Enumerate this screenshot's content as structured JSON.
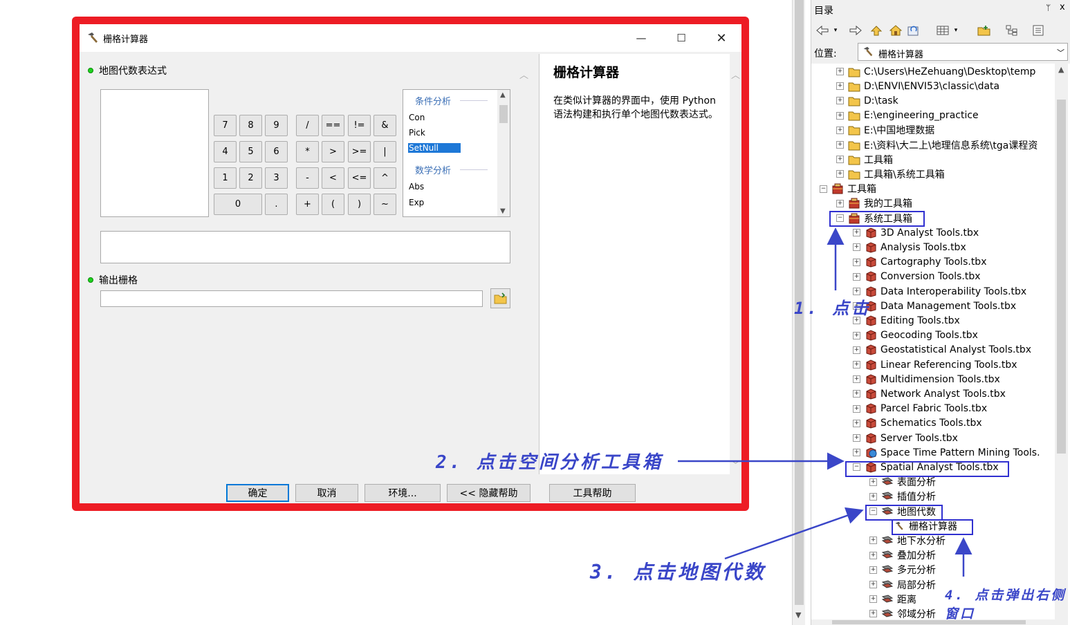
{
  "dialog": {
    "title": "栅格计算器",
    "expr_label": "地图代数表达式",
    "output_label": "输出栅格",
    "calc_buttons": [
      [
        "7",
        "8",
        "9",
        "/",
        "==",
        "!=",
        "&"
      ],
      [
        "4",
        "5",
        "6",
        "*",
        ">",
        ">=",
        "|"
      ],
      [
        "1",
        "2",
        "3",
        "-",
        "<",
        "<=",
        "^"
      ],
      [
        "0",
        ".",
        "+",
        "(",
        ")",
        "~"
      ]
    ],
    "function_list": {
      "groups": [
        {
          "header": "条件分析",
          "items": [
            "Con",
            "Pick",
            "SetNull"
          ]
        },
        {
          "header": "数学分析",
          "items": [
            "Abs",
            "Exp"
          ]
        }
      ],
      "selected": "SetNull"
    },
    "help": {
      "title": "栅格计算器",
      "text": "在类似计算器的界面中，使用 Python 语法构建和执行单个地图代数表达式。"
    },
    "buttons": {
      "ok": "确定",
      "cancel": "取消",
      "env": "环境...",
      "hide_help": "<< 隐藏帮助",
      "tool_help": "工具帮助"
    },
    "window_controls": {
      "min": "—",
      "max": "☐",
      "close": "✕"
    }
  },
  "catalog": {
    "title": "目录",
    "pin": "ᛘ",
    "close": "x",
    "location_label": "位置:",
    "location_value": "栅格计算器",
    "tree": [
      {
        "label": "C:\\Users\\HeZehuang\\Desktop\\temp",
        "type": "folder",
        "level": 1,
        "expander": "+"
      },
      {
        "label": "D:\\ENVI\\ENVI53\\classic\\data",
        "type": "folder",
        "level": 1,
        "expander": "+"
      },
      {
        "label": "D:\\task",
        "type": "folder",
        "level": 1,
        "expander": "+"
      },
      {
        "label": "E:\\engineering_practice",
        "type": "folder",
        "level": 1,
        "expander": "+"
      },
      {
        "label": "E:\\中国地理数据",
        "type": "folder",
        "level": 1,
        "expander": "+"
      },
      {
        "label": "E:\\资料\\大二上\\地理信息系统\\tga课程资",
        "type": "folder",
        "level": 1,
        "expander": "+"
      },
      {
        "label": "工具箱",
        "type": "folder",
        "level": 1,
        "expander": "+"
      },
      {
        "label": "工具箱\\系统工具箱",
        "type": "folder",
        "level": 1,
        "expander": "+"
      },
      {
        "label": "工具箱",
        "type": "toolboxes",
        "level": 0,
        "expander": "−"
      },
      {
        "label": "我的工具箱",
        "type": "toolboxes",
        "level": 1,
        "expander": "+"
      },
      {
        "label": "系统工具箱",
        "type": "toolboxes",
        "level": 1,
        "expander": "−"
      },
      {
        "label": "3D Analyst Tools.tbx",
        "type": "tbx",
        "level": 2,
        "expander": "+"
      },
      {
        "label": "Analysis Tools.tbx",
        "type": "tbx",
        "level": 2,
        "expander": "+"
      },
      {
        "label": "Cartography Tools.tbx",
        "type": "tbx",
        "level": 2,
        "expander": "+"
      },
      {
        "label": "Conversion Tools.tbx",
        "type": "tbx",
        "level": 2,
        "expander": "+"
      },
      {
        "label": "Data Interoperability Tools.tbx",
        "type": "tbx",
        "level": 2,
        "expander": "+"
      },
      {
        "label": "Data Management Tools.tbx",
        "type": "tbx",
        "level": 2,
        "expander": "+"
      },
      {
        "label": "Editing Tools.tbx",
        "type": "tbx",
        "level": 2,
        "expander": "+"
      },
      {
        "label": "Geocoding Tools.tbx",
        "type": "tbx",
        "level": 2,
        "expander": "+"
      },
      {
        "label": "Geostatistical Analyst Tools.tbx",
        "type": "tbx",
        "level": 2,
        "expander": "+"
      },
      {
        "label": "Linear Referencing Tools.tbx",
        "type": "tbx",
        "level": 2,
        "expander": "+"
      },
      {
        "label": "Multidimension Tools.tbx",
        "type": "tbx",
        "level": 2,
        "expander": "+"
      },
      {
        "label": "Network Analyst Tools.tbx",
        "type": "tbx",
        "level": 2,
        "expander": "+"
      },
      {
        "label": "Parcel Fabric Tools.tbx",
        "type": "tbx",
        "level": 2,
        "expander": "+"
      },
      {
        "label": "Schematics Tools.tbx",
        "type": "tbx",
        "level": 2,
        "expander": "+"
      },
      {
        "label": "Server Tools.tbx",
        "type": "tbx",
        "level": 2,
        "expander": "+"
      },
      {
        "label": "Space Time Pattern Mining Tools.",
        "type": "tbx-globe",
        "level": 2,
        "expander": "+"
      },
      {
        "label": "Spatial Analyst Tools.tbx",
        "type": "tbx",
        "level": 2,
        "expander": "−"
      },
      {
        "label": "表面分析",
        "type": "toolset",
        "level": 3,
        "expander": "+"
      },
      {
        "label": "插值分析",
        "type": "toolset",
        "level": 3,
        "expander": "+"
      },
      {
        "label": "地图代数",
        "type": "toolset",
        "level": 3,
        "expander": "−"
      },
      {
        "label": "栅格计算器",
        "type": "tool",
        "level": 4,
        "expander": ""
      },
      {
        "label": "地下水分析",
        "type": "toolset",
        "level": 3,
        "expander": "+"
      },
      {
        "label": "叠加分析",
        "type": "toolset",
        "level": 3,
        "expander": "+"
      },
      {
        "label": "多元分析",
        "type": "toolset",
        "level": 3,
        "expander": "+"
      },
      {
        "label": "局部分析",
        "type": "toolset",
        "level": 3,
        "expander": "+"
      },
      {
        "label": "距离",
        "type": "toolset",
        "level": 3,
        "expander": "+"
      },
      {
        "label": "邻域分析",
        "type": "toolset",
        "level": 3,
        "expander": "+"
      }
    ]
  },
  "annotations": {
    "step1": "1. 点击",
    "step2": "2. 点击空间分析工具箱",
    "step3": "3. 点击地图代数",
    "step4_line1": "4. 点击弹出右侧",
    "step4_line2": "窗口"
  },
  "colors": {
    "frame_red": "#ed1c24",
    "annotation_blue": "#3a46c8",
    "selection_blue": "#1e78d7",
    "ok_dot_green": "#1ed21e"
  }
}
